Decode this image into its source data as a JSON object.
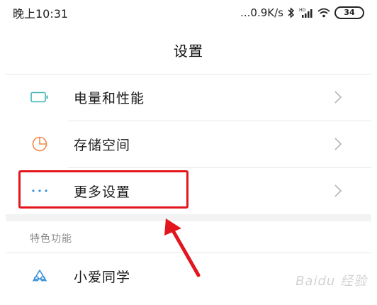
{
  "status_bar": {
    "time": "晚上10:31",
    "network_speed": "...0.9K/s",
    "battery_level": "34",
    "icons": [
      "bluetooth-icon",
      "signal-icon",
      "wifi-icon",
      "battery-icon"
    ]
  },
  "page": {
    "title": "设置"
  },
  "settings_rows": [
    {
      "label": "电量和性能",
      "icon": "battery-icon",
      "icon_color": "#3fb6b3"
    },
    {
      "label": "存储空间",
      "icon": "pie-chart-icon",
      "icon_color": "#f08a4b"
    },
    {
      "label": "更多设置",
      "icon": "more-dots-icon",
      "icon_color": "#3a8fd9"
    }
  ],
  "features_section": {
    "header": "特色功能",
    "rows": [
      {
        "label": "小爱同学",
        "icon": "xiaoai-icon",
        "icon_color": "#3a8fd9"
      }
    ]
  },
  "annotation": {
    "highlight_color": "#e2161c"
  },
  "watermark": {
    "text": "Baidu 经验"
  }
}
